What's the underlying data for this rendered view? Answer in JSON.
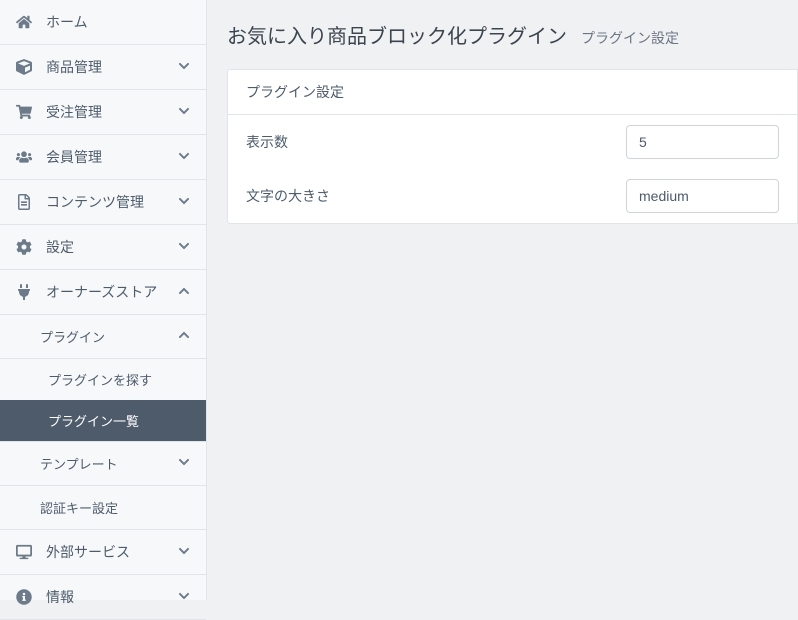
{
  "sidebar": {
    "items": [
      {
        "label": "ホーム",
        "icon": "home"
      },
      {
        "label": "商品管理",
        "icon": "cube",
        "chevron": "down"
      },
      {
        "label": "受注管理",
        "icon": "cart",
        "chevron": "down"
      },
      {
        "label": "会員管理",
        "icon": "users",
        "chevron": "down"
      },
      {
        "label": "コンテンツ管理",
        "icon": "file",
        "chevron": "down"
      },
      {
        "label": "設定",
        "icon": "gear",
        "chevron": "down"
      },
      {
        "label": "オーナーズストア",
        "icon": "plug",
        "chevron": "up"
      },
      {
        "label": "外部サービス",
        "icon": "monitor",
        "chevron": "down"
      },
      {
        "label": "情報",
        "icon": "info",
        "chevron": "down"
      }
    ],
    "owner_store": {
      "plugin_label": "プラグイン",
      "plugin_sub": [
        {
          "label": "プラグインを探す"
        },
        {
          "label": "プラグイン一覧",
          "active": true
        }
      ],
      "template_label": "テンプレート",
      "auth_key_label": "認証キー設定"
    }
  },
  "header": {
    "title": "お気に入り商品ブロック化プラグイン",
    "subtitle": "プラグイン設定"
  },
  "panel": {
    "title": "プラグイン設定",
    "fields": {
      "count_label": "表示数",
      "count_value": "5",
      "size_label": "文字の大きさ",
      "size_value": "medium"
    }
  }
}
